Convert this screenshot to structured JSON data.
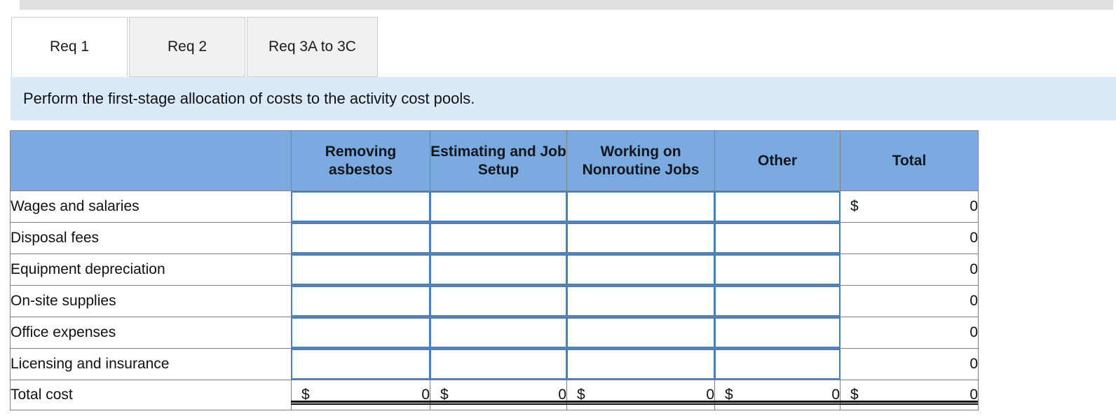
{
  "tabs": [
    {
      "label": "Req 1",
      "active": true
    },
    {
      "label": "Req 2",
      "active": false
    },
    {
      "label": "Req 3A to 3C",
      "active": false
    }
  ],
  "instruction": {
    "text": "Perform the first-stage allocation of costs to the activity cost pools."
  },
  "table": {
    "corner_header": "",
    "columns": [
      "Removing asbestos",
      "Estimating and Job Setup",
      "Working on Nonroutine Jobs",
      "Other",
      "Total"
    ],
    "rows": [
      {
        "label": "Wages and salaries",
        "inputs": [
          "",
          "",
          "",
          ""
        ],
        "total_currency": "$",
        "total_value": "0"
      },
      {
        "label": "Disposal fees",
        "inputs": [
          "",
          "",
          "",
          ""
        ],
        "total_currency": "",
        "total_value": "0"
      },
      {
        "label": "Equipment depreciation",
        "inputs": [
          "",
          "",
          "",
          ""
        ],
        "total_currency": "",
        "total_value": "0"
      },
      {
        "label": "On-site supplies",
        "inputs": [
          "",
          "",
          "",
          ""
        ],
        "total_currency": "",
        "total_value": "0"
      },
      {
        "label": "Office expenses",
        "inputs": [
          "",
          "",
          "",
          ""
        ],
        "total_currency": "",
        "total_value": "0"
      },
      {
        "label": "Licensing and insurance",
        "inputs": [
          "",
          "",
          "",
          ""
        ],
        "total_currency": "",
        "total_value": "0"
      }
    ],
    "total_row": {
      "label": "Total cost",
      "cells": [
        {
          "currency": "$",
          "value": "0"
        },
        {
          "currency": "$",
          "value": "0"
        },
        {
          "currency": "$",
          "value": "0"
        },
        {
          "currency": "$",
          "value": "0"
        },
        {
          "currency": "$",
          "value": "0"
        }
      ]
    }
  },
  "colors": {
    "header_blue": "#7aaae0",
    "banner_blue": "#dbeaf8",
    "input_border": "#4a7fbf",
    "grid_line": "#808080",
    "tab_inactive": "#f1f1f1"
  }
}
